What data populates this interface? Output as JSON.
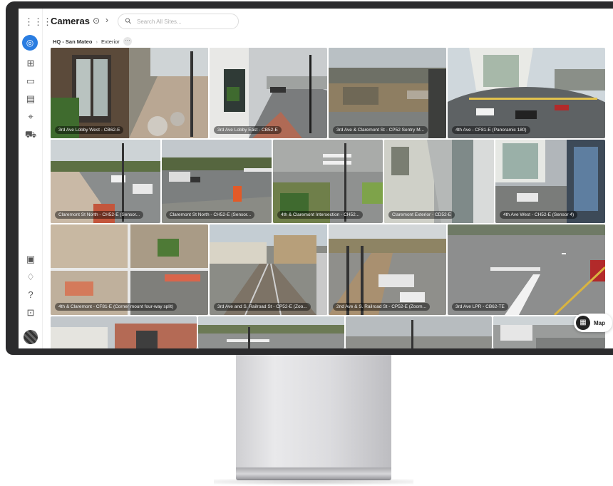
{
  "header": {
    "title": "Cameras",
    "search_placeholder": "Search All Sites..."
  },
  "breadcrumb": {
    "root": "HQ - San Mateo",
    "current": "Exterior",
    "more": "···"
  },
  "sidebar": {
    "top_icons": [
      "apps-grid-icon",
      "camera-icon",
      "layout-grid-icon",
      "archive-icon",
      "reports-icon",
      "person-detection-icon",
      "vehicle-icon"
    ],
    "bottom_icons": [
      "settings-file-icon",
      "bell-icon",
      "help-icon",
      "toolbox-icon"
    ]
  },
  "cameras": [
    {
      "label": "3rd Ave Lobby West - CB62-E"
    },
    {
      "label": "3rd Ave Lobby East - CB52-E"
    },
    {
      "label": "3rd Ave & Claremont St - CP52 Sentry M..."
    },
    {
      "label": "4th Ave - CF81-E (Panoramic 180)"
    },
    {
      "label": "Claremont St North - CH52-E (Sensor..."
    },
    {
      "label": "Claremont St North - CH52-E (Sensor..."
    },
    {
      "label": "4th & Claremont Intersection - CH52..."
    },
    {
      "label": "Claremont Exterior - CD52-E"
    },
    {
      "label": "4th Ave West - CH52-E (Sensor 4)"
    },
    {
      "label": "4th & Claremont - CF81-E (Corner mount four-way split)"
    },
    {
      "label": "3rd Ave and S. Railroad St - CP52-E (Zoo..."
    },
    {
      "label": "2nd Ave & S. Railroad St - CP52-E (Zoom..."
    },
    {
      "label": "3rd Ave LPR - CB62-TE"
    },
    {
      "label": ""
    },
    {
      "label": ""
    },
    {
      "label": ""
    },
    {
      "label": ""
    }
  ],
  "map_button": {
    "label": "Map"
  },
  "colors": {
    "accent": "#2a7de1",
    "bezel": "#2b2b2d"
  }
}
